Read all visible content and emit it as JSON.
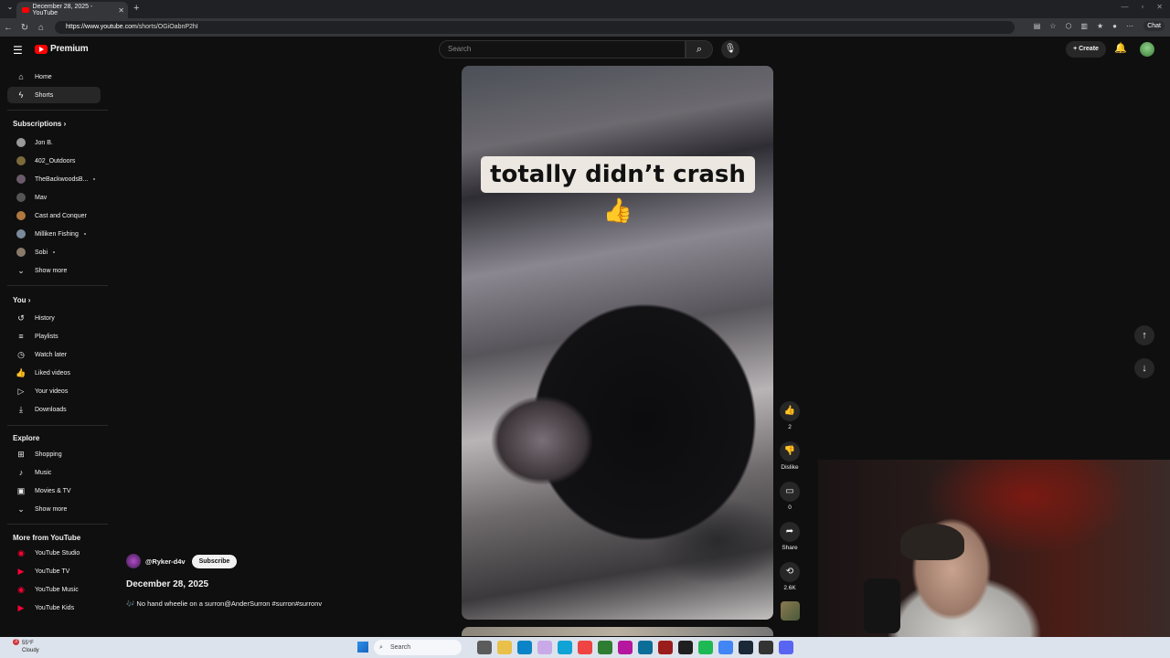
{
  "browser": {
    "tab_title": "December 28, 2025 - YouTube",
    "url_host": "https://www.youtube.com",
    "url_path": "/shorts/OGiOabnP2hI",
    "chat_label": "Chat"
  },
  "header": {
    "logo_text": "Premium",
    "search_placeholder": "Search",
    "create_label": "Create"
  },
  "sidebar": {
    "top_items": [
      {
        "label": "Home",
        "icon": "home-icon"
      },
      {
        "label": "Shorts",
        "icon": "shorts-icon"
      }
    ],
    "subscriptions_heading": "Subscriptions",
    "subscriptions": [
      {
        "label": "Jon B.",
        "color": "#9a9a9a",
        "dot": false
      },
      {
        "label": "402_Outdoors",
        "color": "#7b6a3a",
        "dot": false
      },
      {
        "label": "TheBackwoodsB...",
        "color": "#6a5a6a",
        "dot": true
      },
      {
        "label": "Mav",
        "color": "#555555",
        "dot": false
      },
      {
        "label": "Cast and Conquer",
        "color": "#b07840",
        "dot": false
      },
      {
        "label": "Milliken Fishing",
        "color": "#7a8a9a",
        "dot": true
      },
      {
        "label": "Sobi",
        "color": "#8a7a6a",
        "dot": true
      }
    ],
    "show_more_1": "Show more",
    "you_heading": "You",
    "you_items": [
      {
        "label": "History"
      },
      {
        "label": "Playlists"
      },
      {
        "label": "Watch later"
      },
      {
        "label": "Liked videos"
      },
      {
        "label": "Your videos"
      },
      {
        "label": "Downloads"
      }
    ],
    "explore_heading": "Explore",
    "explore_items": [
      {
        "label": "Shopping"
      },
      {
        "label": "Music"
      },
      {
        "label": "Movies & TV"
      }
    ],
    "show_more_2": "Show more",
    "more_heading": "More from YouTube",
    "more_items": [
      {
        "label": "YouTube Studio"
      },
      {
        "label": "YouTube TV"
      },
      {
        "label": "YouTube Music"
      },
      {
        "label": "YouTube Kids"
      }
    ]
  },
  "video": {
    "caption": "totally didn’t crash",
    "caption_emoji": "👍",
    "channel": "@Ryker-d4v",
    "subscribe_label": "Subscribe",
    "title": "December 28, 2025",
    "description": "🎶 No hand wheelie on a surron@AnderSurron #surron#surronv"
  },
  "actions": {
    "like_count": "2",
    "dislike_label": "Dislike",
    "comment_count": "0",
    "share_label": "Share",
    "remix_count": "2.6K"
  },
  "taskbar": {
    "temp": "55°F",
    "weather": "Cloudy",
    "search_label": "Search",
    "notification_count": "3"
  }
}
